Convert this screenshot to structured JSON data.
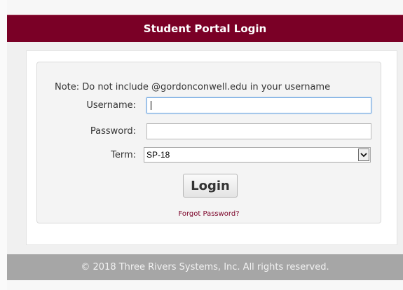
{
  "header": {
    "title": "Student Portal Login"
  },
  "login": {
    "note": "Note: Do not include @gordonconwell.edu in your username",
    "username_label": "Username:",
    "username_value": "",
    "password_label": "Password:",
    "password_value": "",
    "term_label": "Term:",
    "term_selected": "SP-18",
    "login_button": "Login",
    "forgot_link": "Forgot Password?"
  },
  "footer": {
    "text": "© 2018 Three Rivers Systems, Inc. All rights reserved."
  },
  "colors": {
    "brand": "#7a0026",
    "footer": "#a6a6a6",
    "focus_border": "#6ea6e0"
  },
  "icons": {
    "select_arrow": "chevron-down-icon"
  }
}
